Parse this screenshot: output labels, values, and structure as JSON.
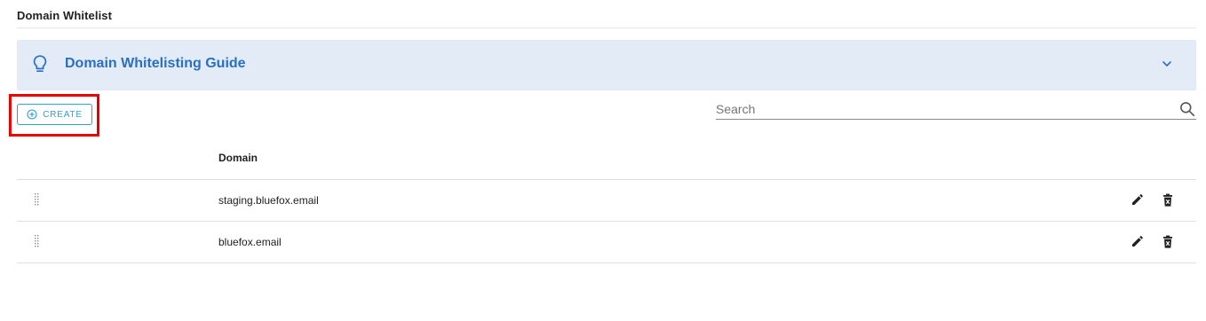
{
  "page": {
    "title": "Domain Whitelist"
  },
  "guide": {
    "title": "Domain Whitelisting Guide",
    "icon": "lightbulb-icon",
    "expand_icon": "chevron-down-icon",
    "background_color": "#e3ebf6",
    "title_color": "#2a6fc1"
  },
  "toolbar": {
    "create_label": "CREATE",
    "create_icon": "add-circle-icon",
    "accent_color": "#2e9ed6",
    "highlight_color": "#e60000"
  },
  "search": {
    "placeholder": "Search",
    "value": "",
    "icon": "search-icon"
  },
  "table": {
    "columns": [
      "",
      "Domain",
      ""
    ],
    "rows": [
      {
        "domain": "staging.bluefox.email"
      },
      {
        "domain": "bluefox.email"
      }
    ],
    "row_actions": [
      "edit-icon",
      "delete-icon"
    ]
  }
}
